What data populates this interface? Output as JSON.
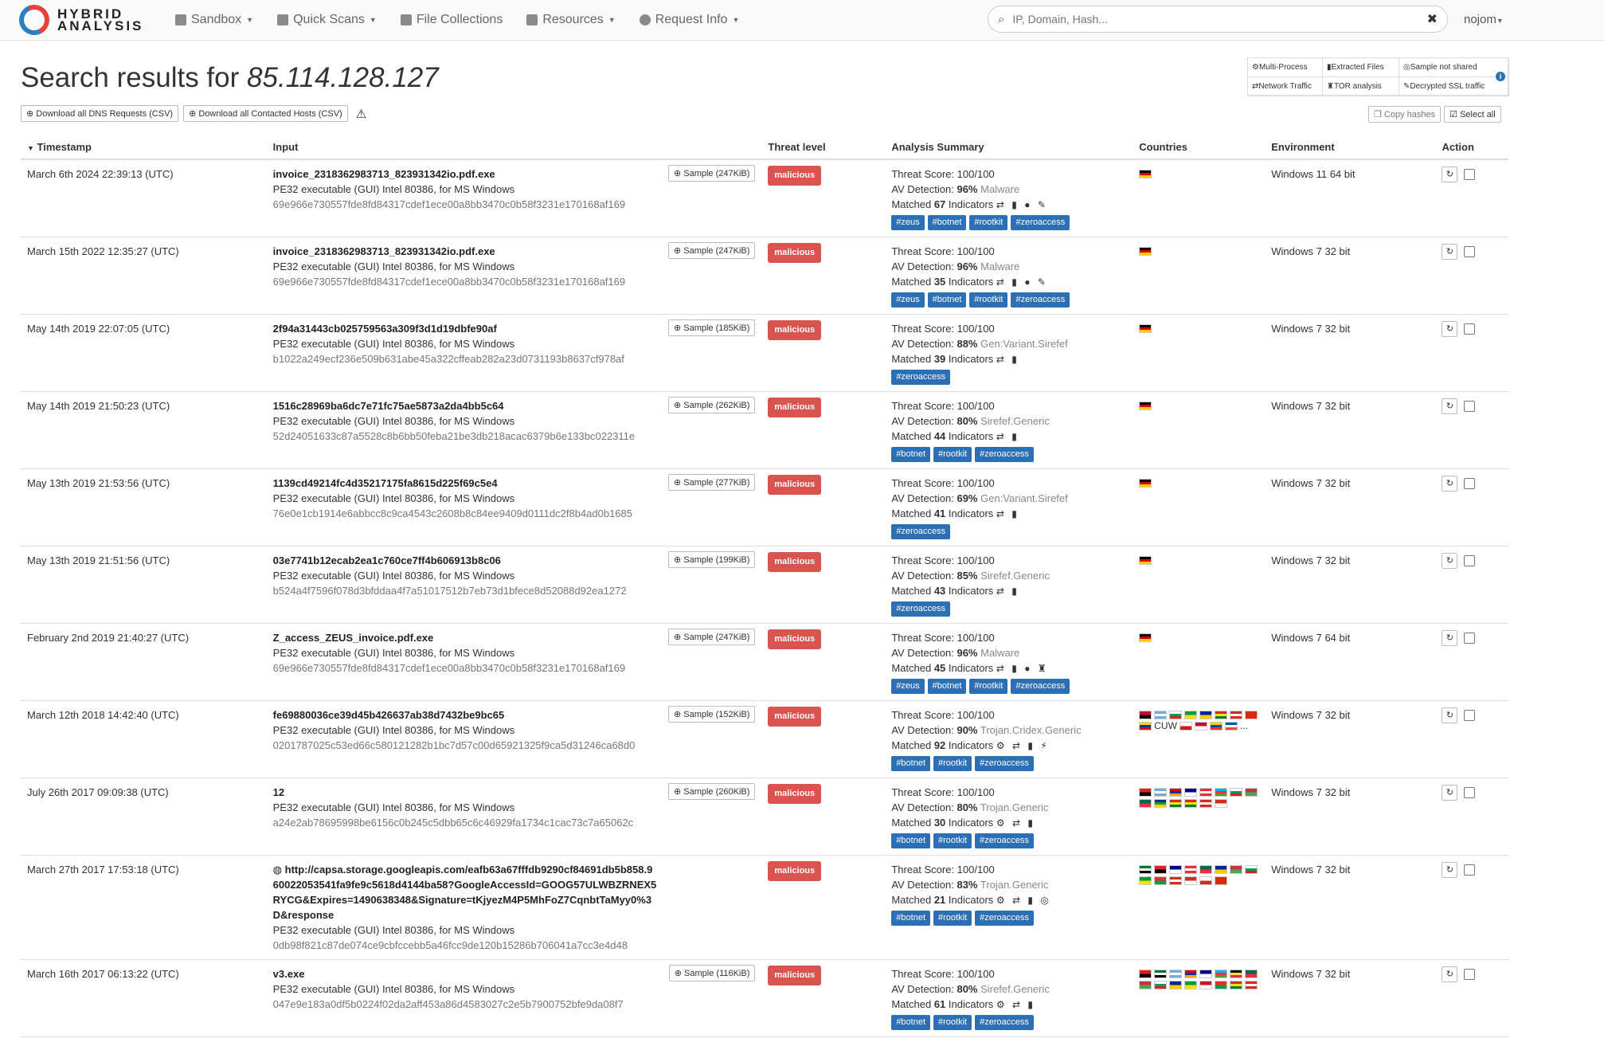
{
  "nav": {
    "brand_line1": "HYBRID",
    "brand_line2": "ANALYSIS",
    "items": [
      {
        "label": "Sandbox",
        "icon": "cube-icon"
      },
      {
        "label": "Quick Scans",
        "icon": "hashtag-icon"
      },
      {
        "label": "File Collections",
        "icon": "files-icon"
      },
      {
        "label": "Resources",
        "icon": "folder-icon"
      },
      {
        "label": "Request Info",
        "icon": "question-circle-icon"
      }
    ],
    "search_placeholder": "IP, Domain, Hash...",
    "user": "nojom"
  },
  "header": {
    "title_prefix": "Search results for",
    "title_query": "85.114.128.127",
    "download_dns": "Download all DNS Requests (CSV)",
    "download_hosts": "Download all Contacted Hosts (CSV)",
    "legend": [
      "Multi-Process",
      "Extracted Files",
      "Sample not shared",
      "Network Traffic",
      "TOR analysis",
      "Decrypted SSL traffic"
    ],
    "copy_hashes": "Copy hashes",
    "select_all": "Select all"
  },
  "columns": [
    "Timestamp",
    "Input",
    "Threat level",
    "Analysis Summary",
    "Countries",
    "Environment",
    "Action"
  ],
  "rows": [
    {
      "ts": "March 6th 2024 22:39:13 (UTC)",
      "name": "invoice_2318362983713_823931342io.pdf.exe",
      "type": "PE32 executable (GUI) Intel 80386, for MS Windows",
      "hash": "69e966e730557fde8fd84317cdef1ece00a8bb3470c0b58f3231e170168af169",
      "sample": "Sample (247KiB)",
      "threat": "malicious",
      "score": "Threat Score: 100/100",
      "av": "96%",
      "av_name": "Malware",
      "matched": "67",
      "icons": "⇄ ▮ ● ✎",
      "tags": [
        "#zeus",
        "#botnet",
        "#rootkit",
        "#zeroaccess"
      ],
      "flags": [
        "de"
      ],
      "env": "Windows 11 64 bit"
    },
    {
      "ts": "March 15th 2022 12:35:27 (UTC)",
      "name": "invoice_2318362983713_823931342io.pdf.exe",
      "type": "PE32 executable (GUI) Intel 80386, for MS Windows",
      "hash": "69e966e730557fde8fd84317cdef1ece00a8bb3470c0b58f3231e170168af169",
      "sample": "Sample (247KiB)",
      "threat": "malicious",
      "score": "Threat Score: 100/100",
      "av": "96%",
      "av_name": "Malware",
      "matched": "35",
      "icons": "⇄ ▮ ● ✎",
      "tags": [
        "#zeus",
        "#botnet",
        "#rootkit",
        "#zeroaccess"
      ],
      "flags": [
        "de"
      ],
      "env": "Windows 7 32 bit"
    },
    {
      "ts": "May 14th 2019 22:07:05 (UTC)",
      "name": "2f94a31443cb025759563a309f3d1d19dbfe90af",
      "type": "PE32 executable (GUI) Intel 80386, for MS Windows",
      "hash": "b1022a249ecf236e509b631abe45a322cffeab282a23d0731193b8637cf978af",
      "sample": "Sample (185KiB)",
      "threat": "malicious",
      "score": "Threat Score: 100/100",
      "av": "88%",
      "av_name": "Gen:Variant.Sirefef",
      "matched": "39",
      "icons": "⇄ ▮",
      "tags": [
        "#zeroaccess"
      ],
      "flags": [
        "de"
      ],
      "env": "Windows 7 32 bit"
    },
    {
      "ts": "May 14th 2019 21:50:23 (UTC)",
      "name": "1516c28969ba6dc7e71fc75ae5873a2da4bb5c64",
      "type": "PE32 executable (GUI) Intel 80386, for MS Windows",
      "hash": "52d24051633c87a5528c8b6bb50feba21be3db218acac6379b6e133bc022311e",
      "sample": "Sample (262KiB)",
      "threat": "malicious",
      "score": "Threat Score: 100/100",
      "av": "80%",
      "av_name": "Sirefef.Generic",
      "matched": "44",
      "icons": "⇄ ▮",
      "tags": [
        "#botnet",
        "#rootkit",
        "#zeroaccess"
      ],
      "flags": [
        "de"
      ],
      "env": "Windows 7 32 bit"
    },
    {
      "ts": "May 13th 2019 21:53:56 (UTC)",
      "name": "1139cd49214fc4d35217175fa8615d225f69c5e4",
      "type": "PE32 executable (GUI) Intel 80386, for MS Windows",
      "hash": "76e0e1cb1914e6abbcc8c9ca4543c2608b8c84ee9409d0111dc2f8b4ad0b1685",
      "sample": "Sample (277KiB)",
      "threat": "malicious",
      "score": "Threat Score: 100/100",
      "av": "69%",
      "av_name": "Gen:Variant.Sirefef",
      "matched": "41",
      "icons": "⇄ ▮",
      "tags": [
        "#zeroaccess"
      ],
      "flags": [
        "de"
      ],
      "env": "Windows 7 32 bit"
    },
    {
      "ts": "May 13th 2019 21:51:56 (UTC)",
      "name": "03e7741b12ecab2ea1c760ce7ff4b606913b8c06",
      "type": "PE32 executable (GUI) Intel 80386, for MS Windows",
      "hash": "b524a4f7596f078d3bfddaa4f7a51017512b7eb73d1bfece8d52088d92ea1272",
      "sample": "Sample (199KiB)",
      "threat": "malicious",
      "score": "Threat Score: 100/100",
      "av": "85%",
      "av_name": "Sirefef.Generic",
      "matched": "43",
      "icons": "⇄ ▮",
      "tags": [
        "#zeroaccess"
      ],
      "flags": [
        "de"
      ],
      "env": "Windows 7 32 bit"
    },
    {
      "ts": "February 2nd 2019 21:40:27 (UTC)",
      "name": "Z_access_ZEUS_invoice.pdf.exe",
      "type": "PE32 executable (GUI) Intel 80386, for MS Windows",
      "hash": "69e966e730557fde8fd84317cdef1ece00a8bb3470c0b58f3231e170168af169",
      "sample": "Sample (247KiB)",
      "threat": "malicious",
      "score": "Threat Score: 100/100",
      "av": "96%",
      "av_name": "Malware",
      "matched": "45",
      "icons": "⇄ ▮ ● ♜",
      "tags": [
        "#zeus",
        "#botnet",
        "#rootkit",
        "#zeroaccess"
      ],
      "flags": [
        "de"
      ],
      "env": "Windows 7 64 bit"
    },
    {
      "ts": "March 12th 2018 14:42:40 (UTC)",
      "name": "fe69880036ce39d45b426637ab38d7432be9bc65",
      "type": "PE32 executable (GUI) Intel 80386, for MS Windows",
      "hash": "0201787025c53ed66c580121282b1bc7d57c00d65921325f9ca5d31246ca68d0",
      "sample": "Sample (152KiB)",
      "threat": "malicious",
      "score": "Threat Score: 100/100",
      "av": "90%",
      "av_name": "Trojan.Cridex.Generic",
      "matched": "92",
      "icons": "⚙ ⇄ ▮ ⚡",
      "tags": [
        "#botnet",
        "#rootkit",
        "#zeroaccess"
      ],
      "flags": [
        "ao",
        "ar",
        "bg",
        "br",
        "ba",
        "bo",
        "ca",
        "cn",
        "co",
        "cuw",
        "cz",
        "dk",
        "ec",
        "fr",
        "more"
      ],
      "env": "Windows 7 32 bit"
    },
    {
      "ts": "July 26th 2017 09:09:38 (UTC)",
      "name": "12",
      "type": "PE32 executable (GUI) Intel 80386, for MS Windows",
      "hash": "a24e2ab78695998be6156c0b245c5dbb65c6c46929fa1734c1cac73c7a65062c",
      "sample": "Sample (260KiB)",
      "threat": "malicious",
      "score": "Threat Score: 100/100",
      "av": "80%",
      "av_name": "Trojan.Generic",
      "matched": "30",
      "icons": "⚙ ⇄ ▮",
      "tags": [
        "#botnet",
        "#rootkit",
        "#zeroaccess"
      ],
      "flags": [
        "al",
        "ar",
        "am",
        "au",
        "at",
        "az",
        "bg",
        "by",
        "bd",
        "cf",
        "bo",
        "bo",
        "ca",
        "ch"
      ],
      "env": "Windows 7 32 bit"
    },
    {
      "ts": "March 27th 2017 17:53:18 (UTC)",
      "url": true,
      "name": "http://capsa.storage.googleapis.com/eafb63a67fffdb9290cf84691db5b858.960022053541fa9fe9c5618d4144ba58?GoogleAccessId=GOOG57ULWBZRNEX5RYCG&Expires=1490638348&Signature=tKjyezM4P5MhFoZ7CqnbtTaMyy0%3D&response",
      "type": "PE32 executable (GUI) Intel 80386, for MS Windows",
      "hash": "0db98f821c87de074ce9cbfccebb5a46fcc9de120b15286b706041a7cc3e4d48",
      "sample": "",
      "threat": "malicious",
      "score": "Threat Score: 100/100",
      "av": "83%",
      "av_name": "Trojan.Generic",
      "matched": "21",
      "icons": "⚙ ⇄ ▮ ◎",
      "tags": [
        "#botnet",
        "#rootkit",
        "#zeroaccess"
      ],
      "flags": [
        "ae",
        "al",
        "au",
        "at",
        "bd",
        "ba",
        "by",
        "bg",
        "br",
        "bf",
        "ca",
        "ch",
        "cl",
        "cn"
      ],
      "env": "Windows 7 32 bit"
    },
    {
      "ts": "March 16th 2017 06:13:22 (UTC)",
      "name": "v3.exe",
      "type": "PE32 executable (GUI) Intel 80386, for MS Windows",
      "hash": "047e9e183a0df5b0224f02da2aff453a86d4583027c2e5b7900752bfe9da08f7",
      "sample": "Sample (116KiB)",
      "threat": "malicious",
      "score": "Threat Score: 100/100",
      "av": "80%",
      "av_name": "Sirefef.Generic",
      "matched": "61",
      "icons": "⚙ ⇄ ▮",
      "tags": [
        "#botnet",
        "#rootkit",
        "#zeroaccess"
      ],
      "flags": [
        "al",
        "ae",
        "ar",
        "am",
        "au",
        "az",
        "be",
        "bd",
        "by",
        "bg",
        "ba",
        "br",
        "bh",
        "bf",
        "bo",
        "ca"
      ],
      "env": "Windows 7 32 bit"
    }
  ],
  "labels": {
    "av_prefix": "AV Detection:",
    "matched_prefix": "Matched",
    "matched_suffix": "Indicators",
    "more_flags": "..."
  }
}
